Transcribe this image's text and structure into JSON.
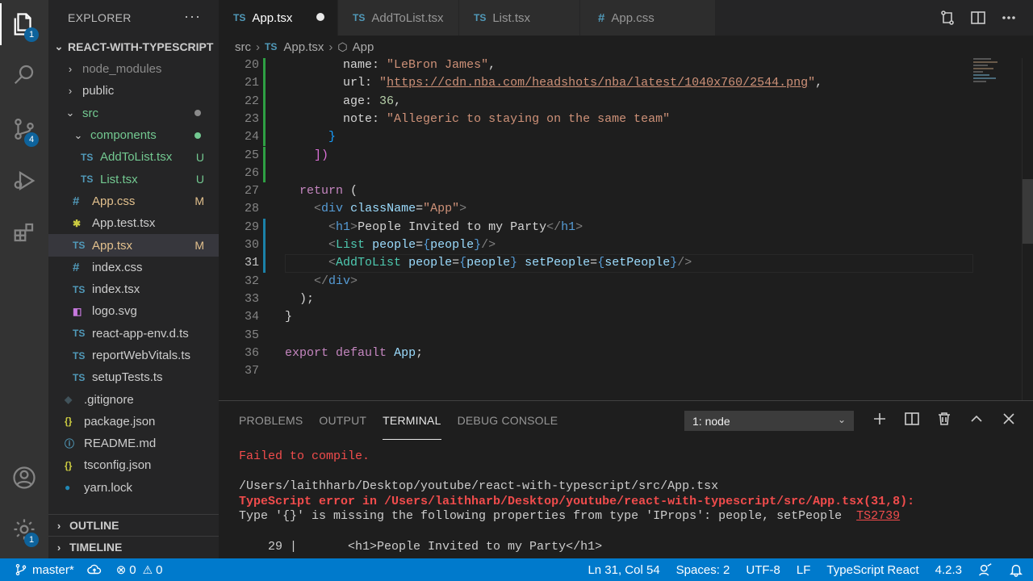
{
  "colors": {
    "accent": "#007acc",
    "activity_bg": "#333333",
    "sidebar_bg": "#252526",
    "editor_bg": "#1e1e1e",
    "badge": "#0e639c",
    "error": "#f14c4c",
    "added": "#2ea043"
  },
  "activity": [
    {
      "name": "explorer-icon",
      "badge": "1"
    },
    {
      "name": "search-icon"
    },
    {
      "name": "source-control-icon",
      "badge": "4"
    },
    {
      "name": "run-debug-icon"
    },
    {
      "name": "extensions-icon"
    },
    {
      "name": "accounts-icon"
    },
    {
      "name": "settings-gear-icon",
      "badge": "1"
    }
  ],
  "sidebar": {
    "title": "EXPLORER",
    "more": "···",
    "project": "REACT-WITH-TYPESCRIPT",
    "tree": [
      {
        "label": "node_modules",
        "kind": "folder",
        "open": false,
        "depth": 0,
        "color": "#8b8b8b"
      },
      {
        "label": "public",
        "kind": "folder",
        "open": false,
        "depth": 0
      },
      {
        "label": "src",
        "kind": "folder",
        "open": true,
        "depth": 0,
        "color": "#73c991",
        "dot": "#8a8a8a"
      },
      {
        "label": "components",
        "kind": "folder",
        "open": true,
        "depth": 1,
        "color": "#73c991",
        "dot": "#73c991"
      },
      {
        "label": "AddToList.tsx",
        "kind": "ts",
        "icon": "TS",
        "depth": 2,
        "color": "#73c991",
        "status": "U"
      },
      {
        "label": "List.tsx",
        "kind": "ts",
        "icon": "TS",
        "depth": 2,
        "color": "#73c991",
        "status": "U"
      },
      {
        "label": "App.css",
        "kind": "css",
        "icon": "#",
        "depth": 1,
        "color": "#e2c08d",
        "status": "M"
      },
      {
        "label": "App.test.tsx",
        "kind": "test",
        "icon": "✱",
        "depth": 1
      },
      {
        "label": "App.tsx",
        "kind": "ts",
        "icon": "TS",
        "depth": 1,
        "color": "#e2c08d",
        "status": "M",
        "selected": true
      },
      {
        "label": "index.css",
        "kind": "css",
        "icon": "#",
        "depth": 1
      },
      {
        "label": "index.tsx",
        "kind": "ts",
        "icon": "TS",
        "depth": 1
      },
      {
        "label": "logo.svg",
        "kind": "svg",
        "icon": "◧",
        "depth": 1
      },
      {
        "label": "react-app-env.d.ts",
        "kind": "ts",
        "icon": "TS",
        "depth": 1
      },
      {
        "label": "reportWebVitals.ts",
        "kind": "ts",
        "icon": "TS",
        "depth": 1
      },
      {
        "label": "setupTests.ts",
        "kind": "ts",
        "icon": "TS",
        "depth": 1
      },
      {
        "label": ".gitignore",
        "kind": "git",
        "icon": "◆",
        "depth": 0
      },
      {
        "label": "package.json",
        "kind": "json",
        "icon": "{}",
        "depth": 0
      },
      {
        "label": "README.md",
        "kind": "md",
        "icon": "ⓘ",
        "depth": 0
      },
      {
        "label": "tsconfig.json",
        "kind": "json",
        "icon": "{}",
        "depth": 0
      },
      {
        "label": "yarn.lock",
        "kind": "yarn",
        "icon": "●",
        "depth": 0
      }
    ],
    "outline": "OUTLINE",
    "timeline": "TIMELINE"
  },
  "tabs": [
    {
      "icon": "TS",
      "label": "App.tsx",
      "active": true,
      "dirty": true
    },
    {
      "icon": "TS",
      "label": "AddToList.tsx"
    },
    {
      "icon": "TS",
      "label": "List.tsx"
    },
    {
      "icon": "#",
      "label": "App.css"
    }
  ],
  "breadcrumb": {
    "folder": "src",
    "file_icon": "TS",
    "file": "App.tsx",
    "symbol": "App"
  },
  "editor": {
    "current_line": "31",
    "lines": [
      {
        "n": "20",
        "g": "add",
        "tokens": [
          [
            "        ",
            "d"
          ],
          [
            "name",
            "d"
          ],
          [
            ": ",
            "d"
          ],
          [
            "\"LeBron James\"",
            "s"
          ],
          [
            ",",
            "d"
          ]
        ]
      },
      {
        "n": "21",
        "g": "add",
        "tokens": [
          [
            "        ",
            "d"
          ],
          [
            "url",
            "d"
          ],
          [
            ": ",
            "d"
          ],
          [
            "\"",
            "s"
          ],
          [
            "https://cdn.nba.com/headshots/nba/latest/1040x760/2544.png",
            "su"
          ],
          [
            "\"",
            "s"
          ],
          [
            ",",
            "d"
          ]
        ]
      },
      {
        "n": "22",
        "g": "add",
        "tokens": [
          [
            "        ",
            "d"
          ],
          [
            "age",
            "d"
          ],
          [
            ": ",
            "d"
          ],
          [
            "36",
            "n"
          ],
          [
            ",",
            "d"
          ]
        ]
      },
      {
        "n": "23",
        "g": "add",
        "tokens": [
          [
            "        ",
            "d"
          ],
          [
            "note",
            "d"
          ],
          [
            ": ",
            "d"
          ],
          [
            "\"Allegeric to staying on the same team\"",
            "s"
          ]
        ]
      },
      {
        "n": "24",
        "g": "add",
        "tokens": [
          [
            "      ",
            "d"
          ],
          [
            "}",
            "bb"
          ]
        ]
      },
      {
        "n": "25",
        "g": "add",
        "tokens": [
          [
            "    ",
            "d"
          ],
          [
            "])",
            "b"
          ]
        ]
      },
      {
        "n": "26",
        "g": "add",
        "tokens": [
          [
            "",
            "d"
          ]
        ]
      },
      {
        "n": "27",
        "tokens": [
          [
            "  ",
            "d"
          ],
          [
            "return",
            "k"
          ],
          [
            " (",
            "d"
          ]
        ]
      },
      {
        "n": "28",
        "tokens": [
          [
            "    ",
            "d"
          ],
          [
            "<",
            "t"
          ],
          [
            "div",
            "kw"
          ],
          [
            " ",
            "d"
          ],
          [
            "className",
            "p"
          ],
          [
            "=",
            "d"
          ],
          [
            "\"App\"",
            "s"
          ],
          [
            ">",
            "t"
          ]
        ]
      },
      {
        "n": "29",
        "g": "mod",
        "tokens": [
          [
            "      ",
            "d"
          ],
          [
            "<",
            "t"
          ],
          [
            "h1",
            "kw"
          ],
          [
            ">",
            "t"
          ],
          [
            "People Invited to my Party",
            "d"
          ],
          [
            "</",
            "t"
          ],
          [
            "h1",
            "kw"
          ],
          [
            ">",
            "t"
          ]
        ]
      },
      {
        "n": "30",
        "g": "mod",
        "tokens": [
          [
            "      ",
            "d"
          ],
          [
            "<",
            "t"
          ],
          [
            "List",
            "tg"
          ],
          [
            " ",
            "d"
          ],
          [
            "people",
            "p"
          ],
          [
            "=",
            "d"
          ],
          [
            "{",
            "kw"
          ],
          [
            "people",
            "p"
          ],
          [
            "}",
            "kw"
          ],
          [
            "/>",
            "t"
          ]
        ]
      },
      {
        "n": "31",
        "g": "mod",
        "tokens": [
          [
            "      ",
            "d"
          ],
          [
            "<",
            "t"
          ],
          [
            "AddToList",
            "tg"
          ],
          [
            " ",
            "d"
          ],
          [
            "people",
            "p"
          ],
          [
            "=",
            "d"
          ],
          [
            "{",
            "kw"
          ],
          [
            "people",
            "p"
          ],
          [
            "}",
            "kw"
          ],
          [
            " ",
            "d"
          ],
          [
            "setPeople",
            "p"
          ],
          [
            "=",
            "d"
          ],
          [
            "{",
            "kw"
          ],
          [
            "setPeople",
            "p"
          ],
          [
            "}",
            "kw"
          ],
          [
            "/>",
            "t"
          ]
        ]
      },
      {
        "n": "32",
        "tokens": [
          [
            "    ",
            "d"
          ],
          [
            "</",
            "t"
          ],
          [
            "div",
            "kw"
          ],
          [
            ">",
            "t"
          ]
        ]
      },
      {
        "n": "33",
        "tokens": [
          [
            "  ",
            "d"
          ],
          [
            ");",
            "d"
          ]
        ]
      },
      {
        "n": "34",
        "tokens": [
          [
            "}",
            "d"
          ]
        ]
      },
      {
        "n": "35",
        "tokens": [
          [
            "",
            "d"
          ]
        ]
      },
      {
        "n": "36",
        "tokens": [
          [
            "export",
            "k"
          ],
          [
            " ",
            "d"
          ],
          [
            "default",
            "k"
          ],
          [
            " ",
            "d"
          ],
          [
            "App",
            "p"
          ],
          [
            ";",
            "d"
          ]
        ]
      },
      {
        "n": "37",
        "tokens": [
          [
            "",
            "d"
          ]
        ]
      }
    ]
  },
  "panel": {
    "tabs": [
      "PROBLEMS",
      "OUTPUT",
      "TERMINAL",
      "DEBUG CONSOLE"
    ],
    "active_tab": "TERMINAL",
    "terminal_select": "1: node",
    "terminal": {
      "line1": "Failed to compile.",
      "line2": "/Users/laithharb/Desktop/youtube/react-with-typescript/src/App.tsx",
      "line3_prefix": "TypeScript error in ",
      "line3_path": "/Users/laithharb/Desktop/youtube/react-with-typescript/src/App.tsx(31,8)",
      "line3_suffix": ":",
      "line4": "Type '{}' is missing the following properties from type 'IProps': people, setPeople  ",
      "line4_code": "TS2739",
      "line5": "    29 |       <h1>People Invited to my Party</h1>"
    }
  },
  "status": {
    "branch": "master*",
    "errors": "0",
    "warnings": "0",
    "position": "Ln 31, Col 54",
    "spaces": "Spaces: 2",
    "encoding": "UTF-8",
    "eol": "LF",
    "language": "TypeScript React",
    "version": "4.2.3"
  }
}
